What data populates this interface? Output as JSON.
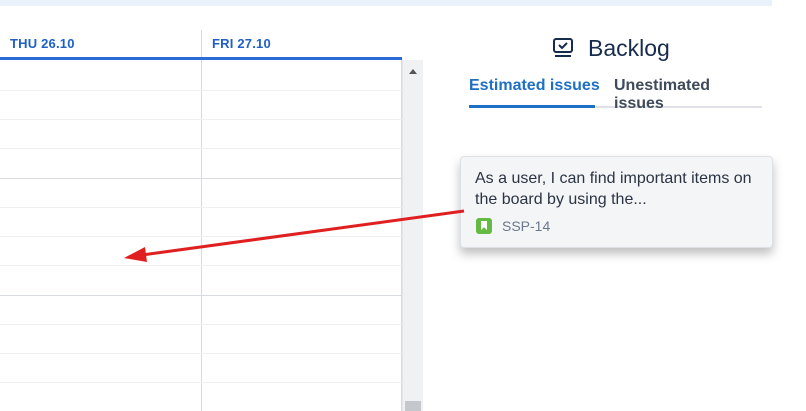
{
  "calendar": {
    "days": [
      {
        "label": "THU 26.10"
      },
      {
        "label": "FRI 27.10"
      }
    ]
  },
  "backlog": {
    "title": "Backlog",
    "tabs": [
      {
        "label": "Estimated issues",
        "active": true
      },
      {
        "label": "Unestimated issues",
        "active": false
      }
    ],
    "card": {
      "summary": "As a user, I can find important items on the board by using the...",
      "issue_type": "story",
      "key": "SSP-14"
    }
  },
  "colors": {
    "accent": "#1f6fc5",
    "story": "#65ba43",
    "arrow": "#e02020"
  },
  "icons": {
    "title": "monitor-icon",
    "issue_type": "story-icon",
    "scroll": "chevron-up-icon"
  }
}
